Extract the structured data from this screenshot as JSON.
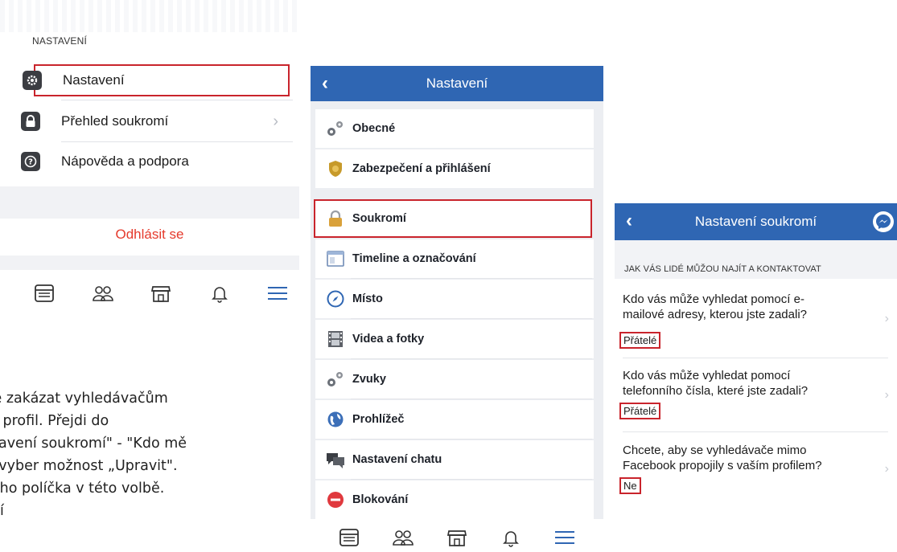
{
  "panel1": {
    "section_label": "NASTAVENÍ",
    "items": [
      {
        "label": "Nastavení",
        "icon": "gear-icon"
      },
      {
        "label": "Přehled soukromí",
        "icon": "lock-icon"
      },
      {
        "label": "Nápověda a podpora",
        "icon": "help-icon"
      }
    ],
    "logout_label": "Odhlásit se",
    "tabs": [
      "news-feed-icon",
      "friends-icon",
      "marketplace-icon",
      "notifications-icon",
      "menu-icon"
    ],
    "colors": {
      "highlight": "#c9242c",
      "logout": "#e53a2c",
      "active_tab": "#2f66b3"
    }
  },
  "caption": {
    "lines": [
      "ké zakázat vyhledávačům",
      "ůj profil. Přejdi do",
      "stavení soukromí\" - \"Kdo mě",
      "a vyber možnost „Upravit\".",
      "tého políčka v této volbě.",
      "utí"
    ]
  },
  "panel2": {
    "title": "Nastavení",
    "items": [
      {
        "label": "Obecné",
        "icon": "gears-icon"
      },
      {
        "label": "Zabezpečení a přihlášení",
        "icon": "badge-icon"
      },
      {
        "label": "Soukromí",
        "icon": "padlock-icon"
      },
      {
        "label": "Timeline a označování",
        "icon": "timeline-icon"
      },
      {
        "label": "Místo",
        "icon": "compass-icon"
      },
      {
        "label": "Videa a fotky",
        "icon": "film-icon"
      },
      {
        "label": "Zvuky",
        "icon": "gears-icon"
      },
      {
        "label": "Prohlížeč",
        "icon": "globe-icon"
      },
      {
        "label": "Nastavení chatu",
        "icon": "chat-icon"
      },
      {
        "label": "Blokování",
        "icon": "block-icon"
      }
    ],
    "tabs": [
      "news-feed-icon",
      "friends-icon",
      "marketplace-icon",
      "notifications-icon",
      "menu-icon"
    ],
    "colors": {
      "header": "#2f66b3"
    }
  },
  "panel3": {
    "title": "Nastavení soukromí",
    "section_label": "JAK VÁS LIDÉ MŮŽOU NAJÍT A KONTAKTOVAT",
    "questions": [
      {
        "q1": "Kdo vás může vyhledat pomocí e-",
        "q2": "mailové adresy, kterou jste zadali?",
        "answer": "Přátelé"
      },
      {
        "q1": "Kdo vás může vyhledat pomocí",
        "q2": "telefonního čísla, které jste zadali?",
        "answer": "Přátelé"
      },
      {
        "q1": "Chcete, aby se vyhledávače mimo",
        "q2": "Facebook propojily s vaším profilem?",
        "answer": "Ne"
      }
    ]
  }
}
